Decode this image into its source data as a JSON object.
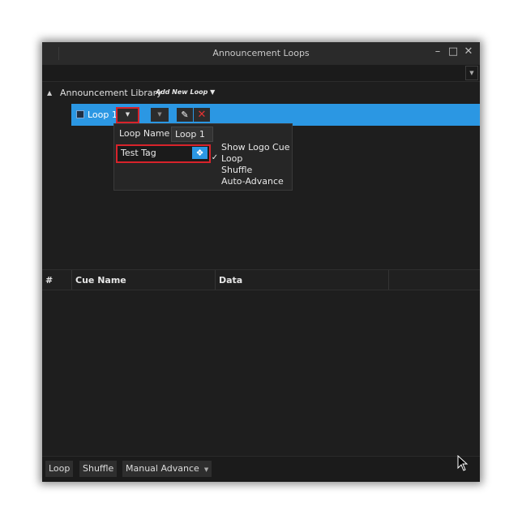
{
  "window": {
    "title": "Announcement Loops",
    "controls": [
      "minimize-icon",
      "maximize-icon",
      "close-icon"
    ]
  },
  "library": {
    "title": "Announcement Library",
    "add_link": "Add New Loop"
  },
  "loop_item": {
    "label": "Loop 1",
    "selected": true,
    "accent_color": "#2b97e3"
  },
  "loop_popup": {
    "name_label": "Loop Name",
    "name_value": "Loop 1",
    "tag_value": "Test Tag",
    "options": [
      {
        "label": "Show Logo Cue",
        "checked": false
      },
      {
        "label": "Loop",
        "checked": true
      },
      {
        "label": "Shuffle",
        "checked": false
      },
      {
        "label": "Auto-Advance",
        "checked": false
      }
    ]
  },
  "cue_grid": {
    "columns": [
      "#",
      "Cue Name",
      "Data"
    ]
  },
  "bottom_bar": {
    "loop_button": "Loop",
    "shuffle_button": "Shuffle",
    "advance_mode": "Manual Advance"
  },
  "colors": {
    "highlight_red": "#d8232b",
    "delete_red": "#e53333",
    "background": "#1e1e1e"
  }
}
